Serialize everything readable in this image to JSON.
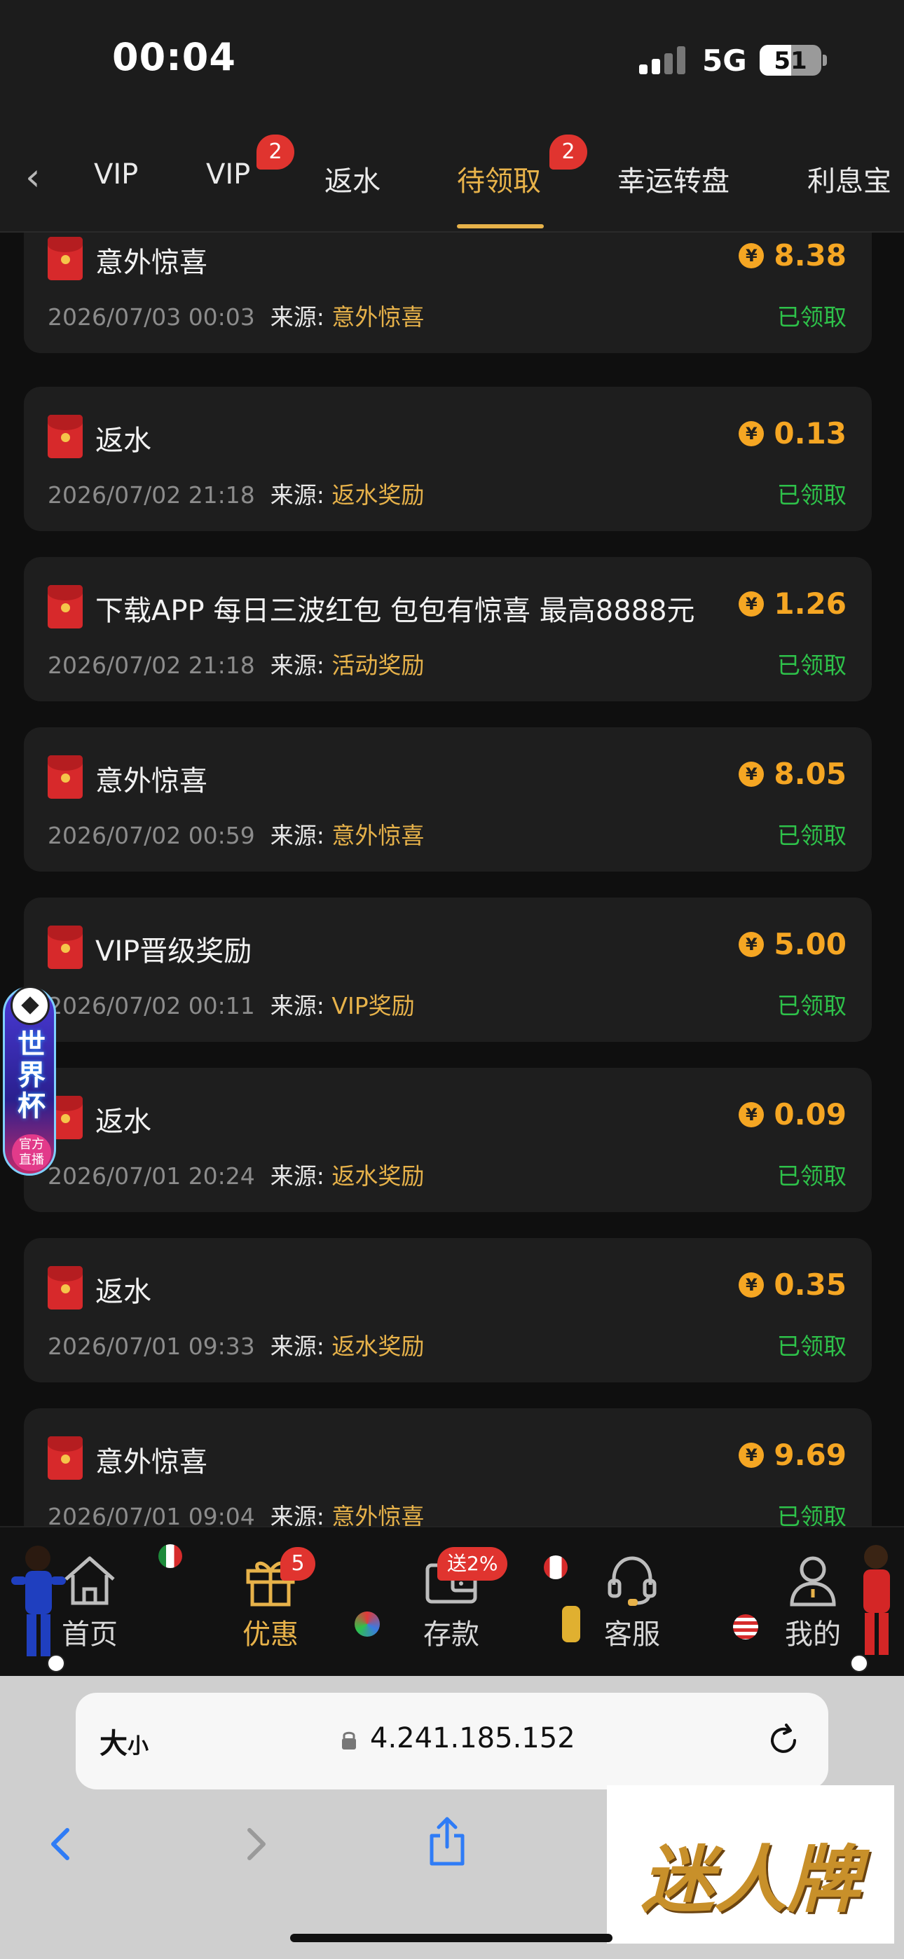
{
  "status_bar": {
    "time": "00:04",
    "network": "5G",
    "battery": "51"
  },
  "tabs": [
    {
      "label": "VIP",
      "active": false
    },
    {
      "label": "VIP",
      "badge": "2",
      "active": false
    },
    {
      "label": "返水",
      "active": false
    },
    {
      "label": "待领取",
      "badge": "2",
      "active": true
    },
    {
      "label": "幸运转盘",
      "active": false
    },
    {
      "label": "利息宝",
      "active": false
    }
  ],
  "records": [
    {
      "title": "意外惊喜",
      "amount": "8.38",
      "date": "2026/07/03 00:03",
      "source_label": "来源:",
      "source": "意外惊喜",
      "status": "已领取"
    },
    {
      "title": "返水",
      "amount": "0.13",
      "date": "2026/07/02 21:18",
      "source_label": "来源:",
      "source": "返水奖励",
      "status": "已领取"
    },
    {
      "title": "下载APP 每日三波红包 包包有惊喜 最高8888元",
      "amount": "1.26",
      "date": "2026/07/02 21:18",
      "source_label": "来源:",
      "source": "活动奖励",
      "status": "已领取"
    },
    {
      "title": "意外惊喜",
      "amount": "8.05",
      "date": "2026/07/02 00:59",
      "source_label": "来源:",
      "source": "意外惊喜",
      "status": "已领取"
    },
    {
      "title": "VIP晋级奖励",
      "amount": "5.00",
      "date": "2026/07/02 00:11",
      "source_label": "来源:",
      "source": "VIP奖励",
      "status": "已领取"
    },
    {
      "title": "返水",
      "amount": "0.09",
      "date": "2026/07/01 20:24",
      "source_label": "来源:",
      "source": "返水奖励",
      "status": "已领取"
    },
    {
      "title": "返水",
      "amount": "0.35",
      "date": "2026/07/01 09:33",
      "source_label": "来源:",
      "source": "返水奖励",
      "status": "已领取"
    },
    {
      "title": "意外惊喜",
      "amount": "9.69",
      "date": "2026/07/01 09:04",
      "source_label": "来源:",
      "source": "意外惊喜",
      "status": "已领取"
    }
  ],
  "coin_symbol": "¥",
  "float_banner": {
    "title": "世界杯",
    "subtitle_line1": "官方",
    "subtitle_line2": "直播"
  },
  "bottom_nav": [
    {
      "label": "首页",
      "icon": "home-icon",
      "active": false
    },
    {
      "label": "优惠",
      "icon": "gift-icon",
      "badge": "5",
      "active": true
    },
    {
      "label": "存款",
      "icon": "wallet-icon",
      "promo": "送2%",
      "active": false
    },
    {
      "label": "客服",
      "icon": "headset-icon",
      "active": false
    },
    {
      "label": "我的",
      "icon": "user-icon",
      "active": false
    }
  ],
  "browser": {
    "size_label": "大",
    "size_small": "小",
    "url": "4.241.185.152"
  },
  "watermark": "迷人牌",
  "colors": {
    "accent": "#e7b24a",
    "amount": "#f5a623",
    "success": "#2ec24a",
    "badge": "#e0342f",
    "card": "#1e1e1e"
  }
}
